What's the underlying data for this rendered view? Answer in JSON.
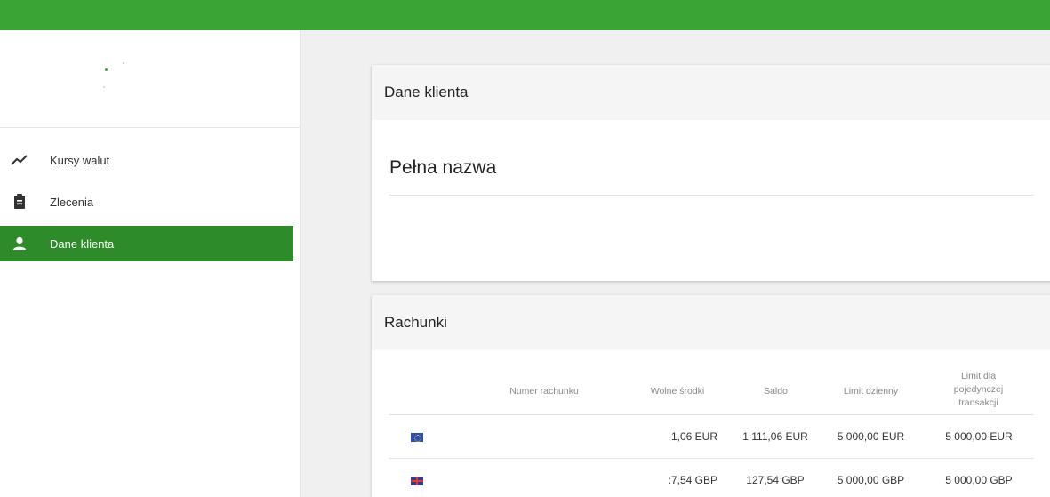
{
  "colors": {
    "top_bar": "#3aa534",
    "active_nav": "#2e8b2a"
  },
  "sidebar": {
    "items": [
      {
        "label": "Kursy walut",
        "icon": "trending-up-icon",
        "active": false
      },
      {
        "label": "Zlecenia",
        "icon": "clipboard-icon",
        "active": false
      },
      {
        "label": "Dane klienta",
        "icon": "person-icon",
        "active": true
      }
    ]
  },
  "client_card": {
    "title": "Dane klienta",
    "field_label": "Pełna nazwa"
  },
  "accounts_card": {
    "title": "Rachunki",
    "columns": {
      "number": "Numer rachunku",
      "available": "Wolne środki",
      "balance": "Saldo",
      "daily_limit": "Limit dzienny",
      "single_limit_l1": "Limit dla",
      "single_limit_l2": "pojedynczej",
      "single_limit_l3": "transakcji"
    },
    "rows": [
      {
        "flag_icon": "eu-flag-icon",
        "available": "1,06 EUR",
        "balance": "1 111,06 EUR",
        "daily_limit": "5 000,00 EUR",
        "single_limit": "5 000,00 EUR"
      },
      {
        "flag_icon": "uk-flag-icon",
        "available": ":7,54 GBP",
        "balance": "127,54 GBP",
        "daily_limit": "5 000,00 GBP",
        "single_limit": "5 000,00 GBP"
      }
    ]
  }
}
